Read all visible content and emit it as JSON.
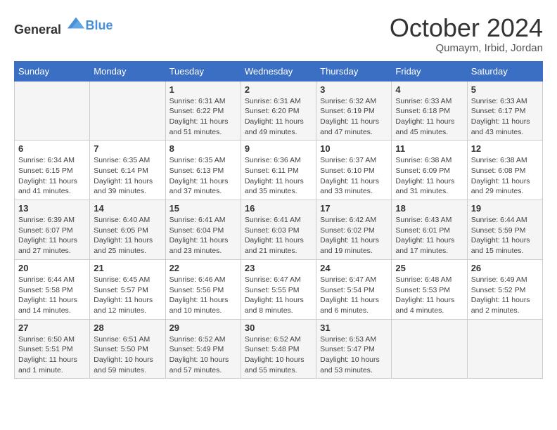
{
  "header": {
    "logo_general": "General",
    "logo_blue": "Blue",
    "month_title": "October 2024",
    "location": "Qumaym, Irbid, Jordan"
  },
  "days_of_week": [
    "Sunday",
    "Monday",
    "Tuesday",
    "Wednesday",
    "Thursday",
    "Friday",
    "Saturday"
  ],
  "weeks": [
    [
      {
        "day": "",
        "sunrise": "",
        "sunset": "",
        "daylight": ""
      },
      {
        "day": "",
        "sunrise": "",
        "sunset": "",
        "daylight": ""
      },
      {
        "day": "1",
        "sunrise": "Sunrise: 6:31 AM",
        "sunset": "Sunset: 6:22 PM",
        "daylight": "Daylight: 11 hours and 51 minutes."
      },
      {
        "day": "2",
        "sunrise": "Sunrise: 6:31 AM",
        "sunset": "Sunset: 6:20 PM",
        "daylight": "Daylight: 11 hours and 49 minutes."
      },
      {
        "day": "3",
        "sunrise": "Sunrise: 6:32 AM",
        "sunset": "Sunset: 6:19 PM",
        "daylight": "Daylight: 11 hours and 47 minutes."
      },
      {
        "day": "4",
        "sunrise": "Sunrise: 6:33 AM",
        "sunset": "Sunset: 6:18 PM",
        "daylight": "Daylight: 11 hours and 45 minutes."
      },
      {
        "day": "5",
        "sunrise": "Sunrise: 6:33 AM",
        "sunset": "Sunset: 6:17 PM",
        "daylight": "Daylight: 11 hours and 43 minutes."
      }
    ],
    [
      {
        "day": "6",
        "sunrise": "Sunrise: 6:34 AM",
        "sunset": "Sunset: 6:15 PM",
        "daylight": "Daylight: 11 hours and 41 minutes."
      },
      {
        "day": "7",
        "sunrise": "Sunrise: 6:35 AM",
        "sunset": "Sunset: 6:14 PM",
        "daylight": "Daylight: 11 hours and 39 minutes."
      },
      {
        "day": "8",
        "sunrise": "Sunrise: 6:35 AM",
        "sunset": "Sunset: 6:13 PM",
        "daylight": "Daylight: 11 hours and 37 minutes."
      },
      {
        "day": "9",
        "sunrise": "Sunrise: 6:36 AM",
        "sunset": "Sunset: 6:11 PM",
        "daylight": "Daylight: 11 hours and 35 minutes."
      },
      {
        "day": "10",
        "sunrise": "Sunrise: 6:37 AM",
        "sunset": "Sunset: 6:10 PM",
        "daylight": "Daylight: 11 hours and 33 minutes."
      },
      {
        "day": "11",
        "sunrise": "Sunrise: 6:38 AM",
        "sunset": "Sunset: 6:09 PM",
        "daylight": "Daylight: 11 hours and 31 minutes."
      },
      {
        "day": "12",
        "sunrise": "Sunrise: 6:38 AM",
        "sunset": "Sunset: 6:08 PM",
        "daylight": "Daylight: 11 hours and 29 minutes."
      }
    ],
    [
      {
        "day": "13",
        "sunrise": "Sunrise: 6:39 AM",
        "sunset": "Sunset: 6:07 PM",
        "daylight": "Daylight: 11 hours and 27 minutes."
      },
      {
        "day": "14",
        "sunrise": "Sunrise: 6:40 AM",
        "sunset": "Sunset: 6:05 PM",
        "daylight": "Daylight: 11 hours and 25 minutes."
      },
      {
        "day": "15",
        "sunrise": "Sunrise: 6:41 AM",
        "sunset": "Sunset: 6:04 PM",
        "daylight": "Daylight: 11 hours and 23 minutes."
      },
      {
        "day": "16",
        "sunrise": "Sunrise: 6:41 AM",
        "sunset": "Sunset: 6:03 PM",
        "daylight": "Daylight: 11 hours and 21 minutes."
      },
      {
        "day": "17",
        "sunrise": "Sunrise: 6:42 AM",
        "sunset": "Sunset: 6:02 PM",
        "daylight": "Daylight: 11 hours and 19 minutes."
      },
      {
        "day": "18",
        "sunrise": "Sunrise: 6:43 AM",
        "sunset": "Sunset: 6:01 PM",
        "daylight": "Daylight: 11 hours and 17 minutes."
      },
      {
        "day": "19",
        "sunrise": "Sunrise: 6:44 AM",
        "sunset": "Sunset: 5:59 PM",
        "daylight": "Daylight: 11 hours and 15 minutes."
      }
    ],
    [
      {
        "day": "20",
        "sunrise": "Sunrise: 6:44 AM",
        "sunset": "Sunset: 5:58 PM",
        "daylight": "Daylight: 11 hours and 14 minutes."
      },
      {
        "day": "21",
        "sunrise": "Sunrise: 6:45 AM",
        "sunset": "Sunset: 5:57 PM",
        "daylight": "Daylight: 11 hours and 12 minutes."
      },
      {
        "day": "22",
        "sunrise": "Sunrise: 6:46 AM",
        "sunset": "Sunset: 5:56 PM",
        "daylight": "Daylight: 11 hours and 10 minutes."
      },
      {
        "day": "23",
        "sunrise": "Sunrise: 6:47 AM",
        "sunset": "Sunset: 5:55 PM",
        "daylight": "Daylight: 11 hours and 8 minutes."
      },
      {
        "day": "24",
        "sunrise": "Sunrise: 6:47 AM",
        "sunset": "Sunset: 5:54 PM",
        "daylight": "Daylight: 11 hours and 6 minutes."
      },
      {
        "day": "25",
        "sunrise": "Sunrise: 6:48 AM",
        "sunset": "Sunset: 5:53 PM",
        "daylight": "Daylight: 11 hours and 4 minutes."
      },
      {
        "day": "26",
        "sunrise": "Sunrise: 6:49 AM",
        "sunset": "Sunset: 5:52 PM",
        "daylight": "Daylight: 11 hours and 2 minutes."
      }
    ],
    [
      {
        "day": "27",
        "sunrise": "Sunrise: 6:50 AM",
        "sunset": "Sunset: 5:51 PM",
        "daylight": "Daylight: 11 hours and 1 minute."
      },
      {
        "day": "28",
        "sunrise": "Sunrise: 6:51 AM",
        "sunset": "Sunset: 5:50 PM",
        "daylight": "Daylight: 10 hours and 59 minutes."
      },
      {
        "day": "29",
        "sunrise": "Sunrise: 6:52 AM",
        "sunset": "Sunset: 5:49 PM",
        "daylight": "Daylight: 10 hours and 57 minutes."
      },
      {
        "day": "30",
        "sunrise": "Sunrise: 6:52 AM",
        "sunset": "Sunset: 5:48 PM",
        "daylight": "Daylight: 10 hours and 55 minutes."
      },
      {
        "day": "31",
        "sunrise": "Sunrise: 6:53 AM",
        "sunset": "Sunset: 5:47 PM",
        "daylight": "Daylight: 10 hours and 53 minutes."
      },
      {
        "day": "",
        "sunrise": "",
        "sunset": "",
        "daylight": ""
      },
      {
        "day": "",
        "sunrise": "",
        "sunset": "",
        "daylight": ""
      }
    ]
  ]
}
